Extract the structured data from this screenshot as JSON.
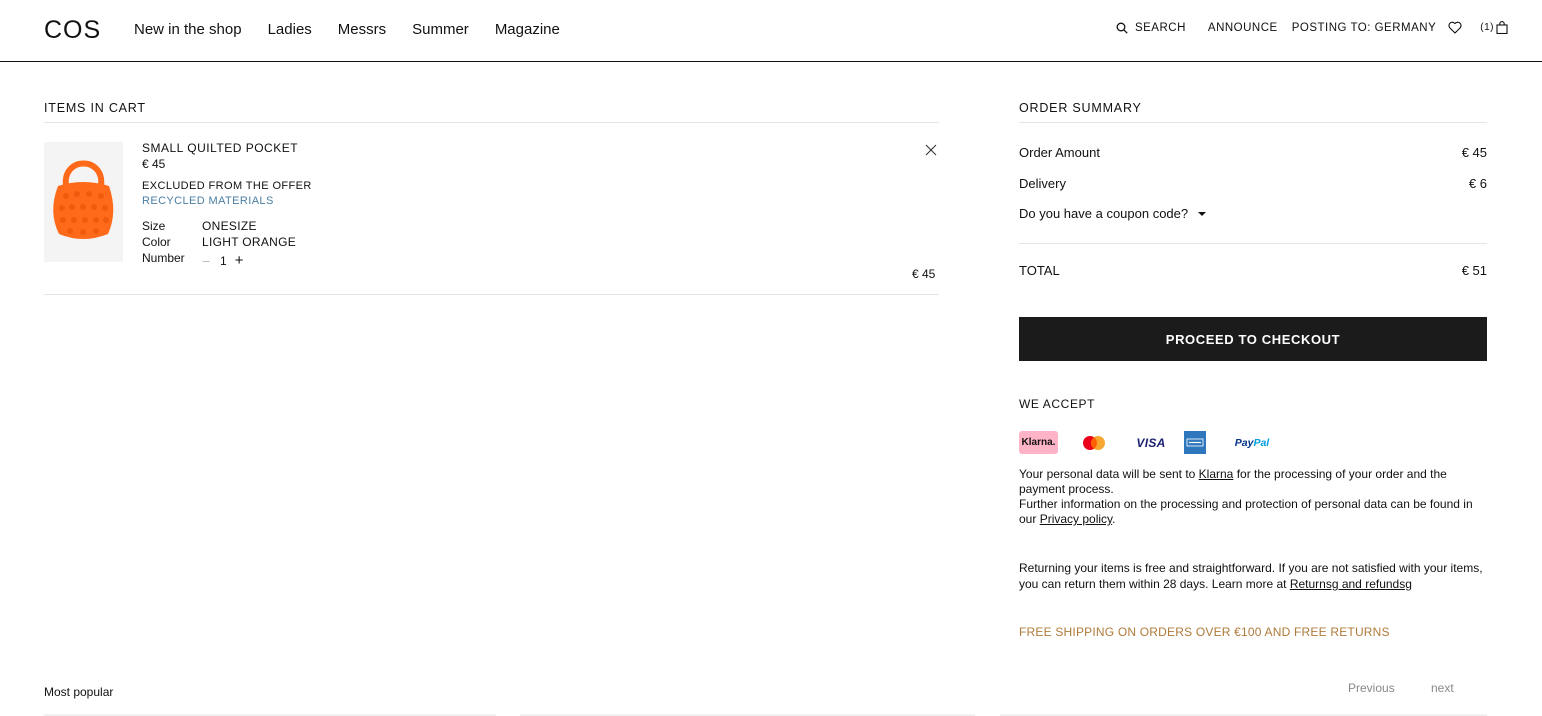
{
  "header": {
    "logo": "COS",
    "nav": [
      "New in the shop",
      "Ladies",
      "Messrs",
      "Summer",
      "Magazine"
    ],
    "search_label": "SEARCH",
    "announce_label": "ANNOUNCE",
    "posting_label": "POSTING TO: GERMANY",
    "bag_count": "(1)"
  },
  "cart": {
    "title": "ITEMS IN CART",
    "item": {
      "name": "SMALL QUILTED POCKET",
      "price": "€ 45",
      "excluded": "EXCLUDED FROM THE OFFER",
      "recycled": "RECYCLED MATERIALS",
      "size_label": "Size",
      "size_value": "ONESIZE",
      "color_label": "Color",
      "color_value": "LIGHT ORANGE",
      "number_label": "Number",
      "quantity": "1",
      "line_total": "€ 45",
      "image_color": "#ff6a1a"
    }
  },
  "summary": {
    "title": "ORDER SUMMARY",
    "order_amount_label": "Order Amount",
    "order_amount_value": "€ 45",
    "delivery_label": "Delivery",
    "delivery_value": "€ 6",
    "coupon_label": "Do you have a coupon code?",
    "total_label": "TOTAL",
    "total_value": "€ 51",
    "checkout_label": "PROCEED TO CHECKOUT",
    "accept_title": "WE ACCEPT",
    "payments": {
      "klarna": "Klarna.",
      "visa": "VISA",
      "paypal_a": "Pay",
      "paypal_b": "Pal"
    },
    "klarna_text_1": "Your personal data will be sent to ",
    "klarna_link": "Klarna",
    "klarna_text_2": " for the processing of your order and the payment process.",
    "klarna_text_3": "Further information on the processing and protection of personal data can be found in our ",
    "privacy_link": "Privacy policy",
    "klarna_text_4": ".",
    "return_text": "Returning your items is free and straightforward. If you are not satisfied with your items, you can return them within 28 days. Learn more at ",
    "return_link": "Returnsg and refundsg",
    "free_shipping": "FREE SHIPPING ON ORDERS OVER €100 AND FREE RETURNS"
  },
  "carousel": {
    "title": "Most popular",
    "previous": "Previous",
    "next": "next"
  }
}
